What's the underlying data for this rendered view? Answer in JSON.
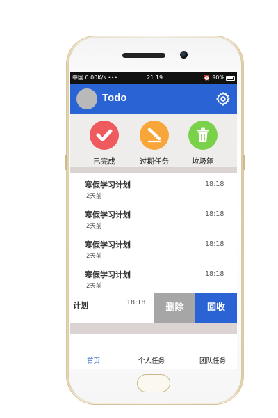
{
  "status_bar": {
    "left": "中国 0.00K/s •••",
    "time": "21:19",
    "right": "⏰ 90%"
  },
  "header": {
    "title": "Todo",
    "bg_color": "#2a63d4"
  },
  "quick_actions": [
    {
      "label": "已完成",
      "icon": "check-icon",
      "color": "#ef5a5e"
    },
    {
      "label": "过期任务",
      "icon": "pencil-icon",
      "color": "#f8a63a"
    },
    {
      "label": "垃圾箱",
      "icon": "trash-icon",
      "color": "#7ad14a"
    }
  ],
  "tasks": [
    {
      "title": "寒假学习计划",
      "ago": "2天前",
      "time": "18:18"
    },
    {
      "title": "寒假学习计划",
      "ago": "2天前",
      "time": "18:18"
    },
    {
      "title": "寒假学习计划",
      "ago": "2天前",
      "time": "18:18"
    },
    {
      "title": "寒假学习计划",
      "ago": "2天前",
      "time": "18:18"
    }
  ],
  "swiped_task": {
    "title": "计划",
    "time": "18:18",
    "delete_label": "删除",
    "recycle_label": "回收"
  },
  "tabs": [
    {
      "label": "首页",
      "active": true
    },
    {
      "label": "个人任务",
      "active": false
    },
    {
      "label": "团队任务",
      "active": false
    }
  ]
}
